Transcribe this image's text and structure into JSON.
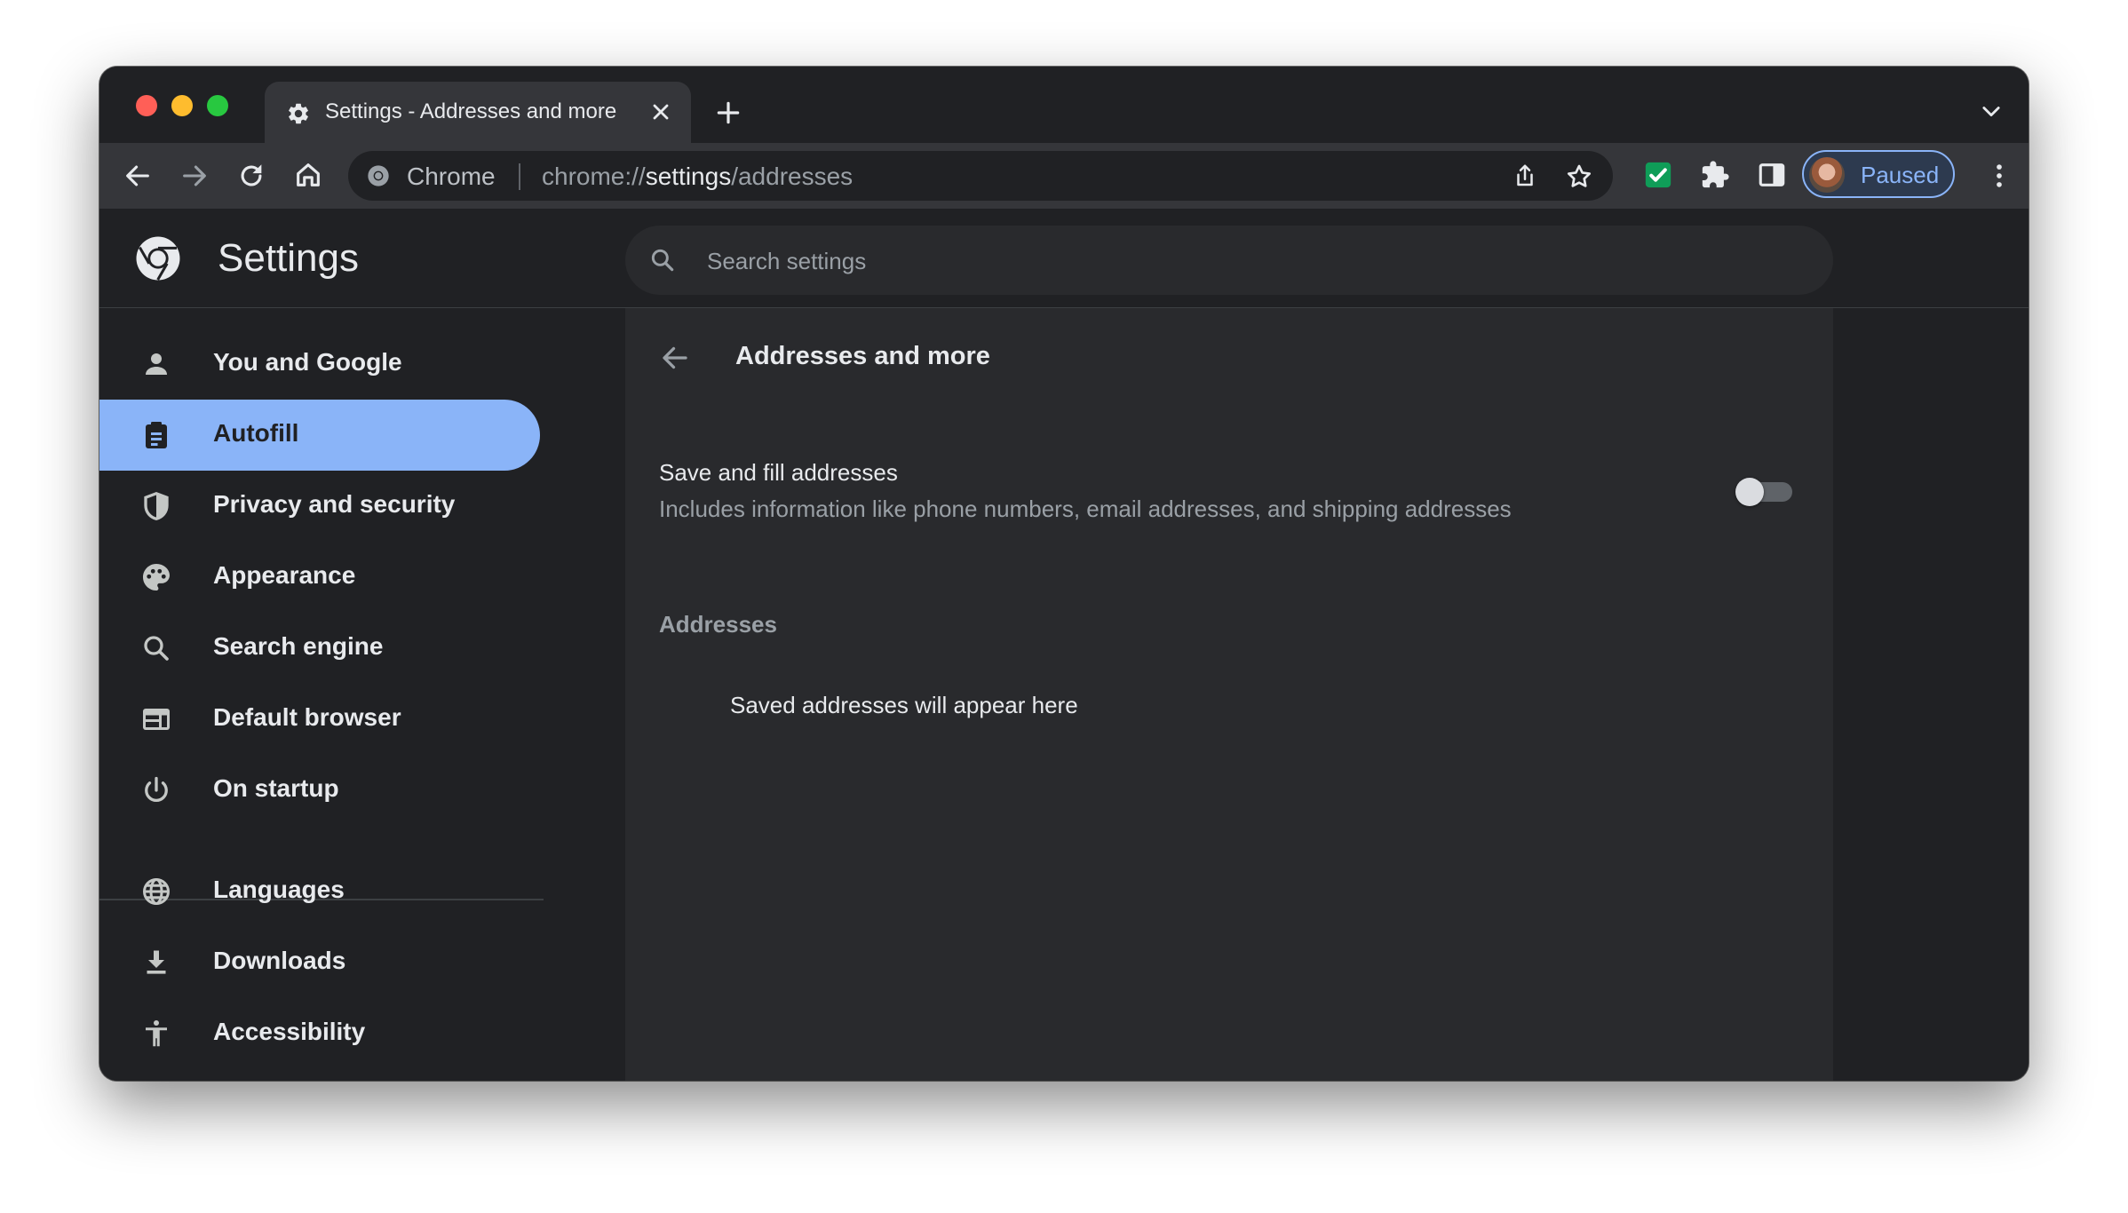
{
  "browser": {
    "tab_title": "Settings - Addresses and more",
    "omnibox_chip": "Chrome",
    "url_scheme": "chrome://",
    "url_host": "settings",
    "url_path": "/addresses",
    "profile_label": "Paused",
    "accent_color": "#8ab4f8"
  },
  "settings": {
    "title": "Settings",
    "search_placeholder": "Search settings"
  },
  "sidebar": {
    "items": [
      {
        "label": "You and Google",
        "icon": "person-icon"
      },
      {
        "label": "Autofill",
        "icon": "clipboard-icon",
        "active": true
      },
      {
        "label": "Privacy and security",
        "icon": "shield-icon"
      },
      {
        "label": "Appearance",
        "icon": "palette-icon"
      },
      {
        "label": "Search engine",
        "icon": "search-icon"
      },
      {
        "label": "Default browser",
        "icon": "browser-icon"
      },
      {
        "label": "On startup",
        "icon": "power-icon"
      },
      {
        "label": "Languages",
        "icon": "globe-icon"
      },
      {
        "label": "Downloads",
        "icon": "download-icon"
      },
      {
        "label": "Accessibility",
        "icon": "accessibility-icon"
      }
    ]
  },
  "main": {
    "page_title": "Addresses and more",
    "save_fill": {
      "title": "Save and fill addresses",
      "description": "Includes information like phone numbers, email addresses, and shipping addresses",
      "enabled": false
    },
    "addresses_heading": "Addresses",
    "empty_message": "Saved addresses will appear here"
  }
}
